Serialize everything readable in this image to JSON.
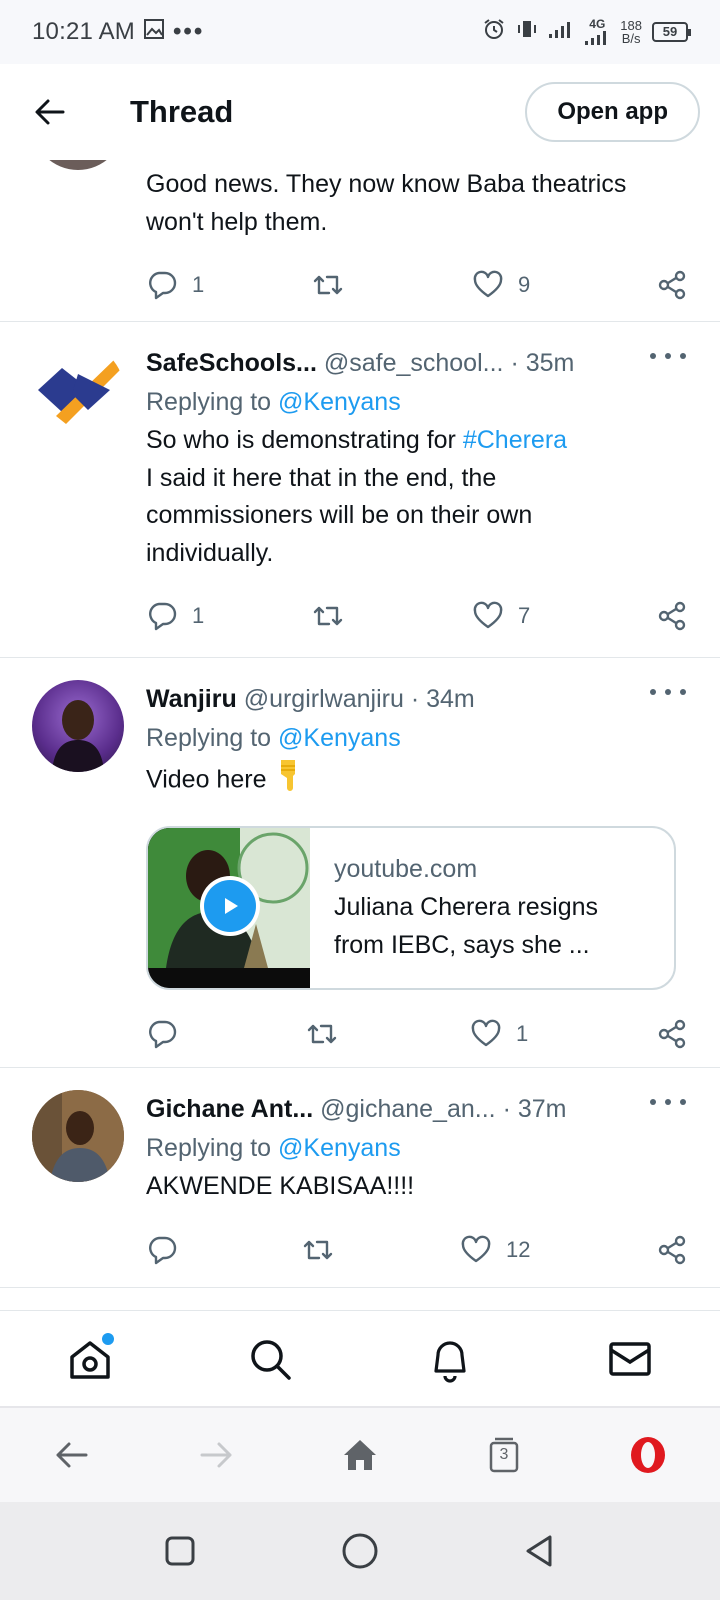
{
  "status_bar": {
    "time": "10:21 AM",
    "network": "4G",
    "speed_value": "188",
    "speed_unit": "B/s",
    "battery": "59"
  },
  "header": {
    "title": "Thread",
    "open_app_label": "Open app"
  },
  "tweets": [
    {
      "body_lines": [
        "Good news. They now know Baba theatrics",
        "won't help them."
      ],
      "replies": "1",
      "retweets": "",
      "likes": "9"
    },
    {
      "name": "SafeSchools...",
      "handle": "@safe_school...",
      "time": "35m",
      "replying_to_label": "Replying to",
      "replying_to": "@Kenyans",
      "body_prefix": "So who is demonstrating for",
      "hashtag": "#Cherera",
      "body_lines": [
        "I said it here that in the end, the",
        "commissioners will be on their own",
        "individually."
      ],
      "replies": "1",
      "retweets": "",
      "likes": "7"
    },
    {
      "name": "Wanjiru",
      "handle": "@urgirlwanjiru",
      "time": "34m",
      "replying_to_label": "Replying to",
      "replying_to": "@Kenyans",
      "body": "Video here",
      "card": {
        "domain": "youtube.com",
        "title_lines": [
          "Juliana Cherera resigns",
          "from IEBC, says she ..."
        ]
      },
      "replies": "",
      "retweets": "",
      "likes": "1"
    },
    {
      "name": "Gichane Ant...",
      "handle": "@gichane_an...",
      "time": "37m",
      "replying_to_label": "Replying to",
      "replying_to": "@Kenyans",
      "body": "AKWENDE KABISAA!!!!",
      "replies": "",
      "retweets": "",
      "likes": "12"
    }
  ],
  "tabs": [
    "home",
    "search",
    "notifications",
    "messages"
  ],
  "browser": {
    "tab_count": "3"
  },
  "colors": {
    "accent": "#1d9bf0",
    "text": "#0f1419",
    "secondary": "#536471",
    "opera_red": "#e0191f"
  }
}
